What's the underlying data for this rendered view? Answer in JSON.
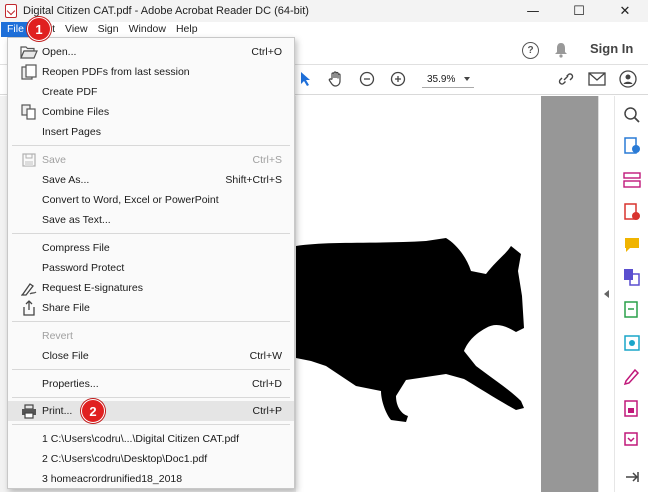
{
  "window": {
    "title": "Digital Citizen CAT.pdf - Adobe Acrobat Reader DC (64-bit)",
    "minimize": "—",
    "maximize": "☐",
    "close": "✕"
  },
  "menubar": {
    "items": [
      "File",
      "Edit",
      "View",
      "Sign",
      "Window",
      "Help"
    ]
  },
  "topbar": {
    "sign_in": "Sign In",
    "help_icon": "?"
  },
  "toolbar": {
    "zoom": "35.9%"
  },
  "file_menu": {
    "items": [
      {
        "label": "Open...",
        "shortcut": "Ctrl+O",
        "icon": "folder-open-icon"
      },
      {
        "label": "Reopen PDFs from last session",
        "shortcut": "",
        "icon": "reopen-icon"
      },
      {
        "label": "Create PDF",
        "shortcut": ""
      },
      {
        "label": "Combine Files",
        "shortcut": "",
        "icon": "combine-icon"
      },
      {
        "label": "Insert Pages",
        "shortcut": ""
      },
      {
        "label": "Save",
        "shortcut": "Ctrl+S",
        "icon": "save-icon",
        "disabled": true
      },
      {
        "label": "Save As...",
        "shortcut": "Shift+Ctrl+S"
      },
      {
        "label": "Convert to Word, Excel or PowerPoint",
        "shortcut": ""
      },
      {
        "label": "Save as Text...",
        "shortcut": ""
      },
      {
        "label": "Compress File",
        "shortcut": ""
      },
      {
        "label": "Password Protect",
        "shortcut": ""
      },
      {
        "label": "Request E-signatures",
        "shortcut": "",
        "icon": "signature-icon"
      },
      {
        "label": "Share File",
        "shortcut": "",
        "icon": "share-icon"
      },
      {
        "label": "Revert",
        "shortcut": "",
        "disabled": true
      },
      {
        "label": "Close File",
        "shortcut": "Ctrl+W"
      },
      {
        "label": "Properties...",
        "shortcut": "Ctrl+D"
      },
      {
        "label": "Print...",
        "shortcut": "Ctrl+P",
        "icon": "printer-icon"
      },
      {
        "label": "1 C:\\Users\\codru\\...\\Digital Citizen CAT.pdf",
        "shortcut": ""
      },
      {
        "label": "2 C:\\Users\\codru\\Desktop\\Doc1.pdf",
        "shortcut": ""
      },
      {
        "label": "3 homeacrordrunified18_2018",
        "shortcut": ""
      }
    ]
  },
  "annotations": {
    "step1": "1",
    "step2": "2"
  },
  "colors": {
    "accent": "#1e6fd9",
    "badge": "#e02020",
    "right_panel_icons": "#c0187a"
  }
}
